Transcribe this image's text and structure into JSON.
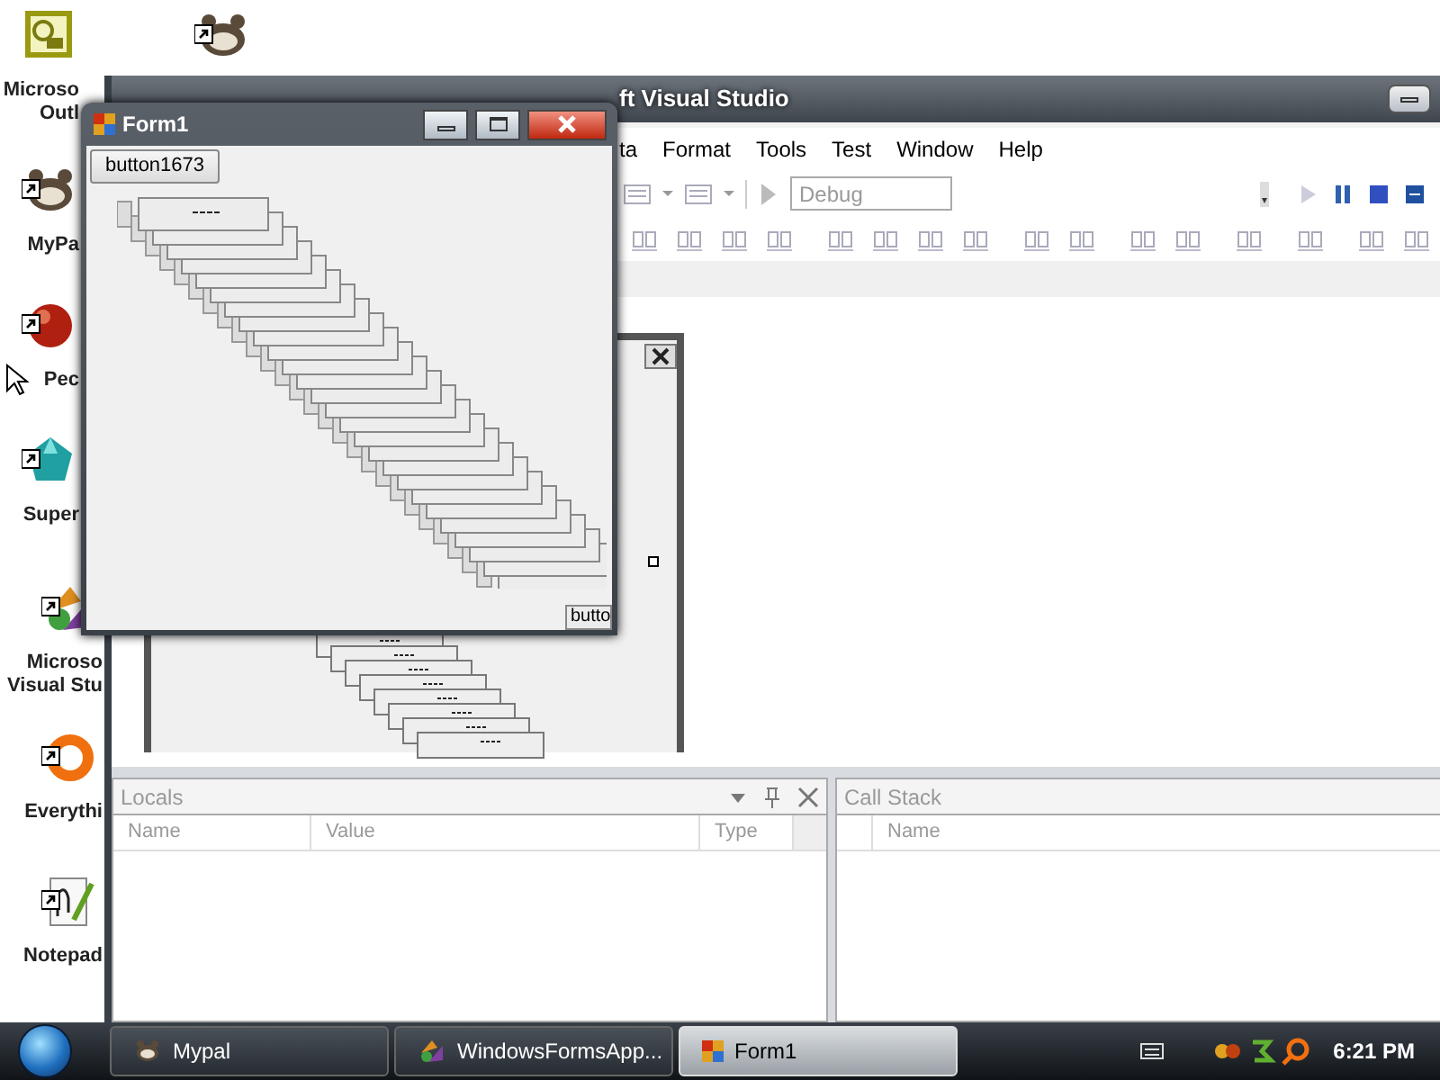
{
  "desktop": {
    "icons": [
      {
        "kind": "calendar",
        "lines": [
          "Microso",
          "Outl"
        ]
      },
      {
        "kind": "animal"
      },
      {
        "kind": "animal",
        "lines": [
          "MyPa"
        ]
      },
      {
        "kind": "ball",
        "lines": [
          "Pec"
        ]
      },
      {
        "kind": "gem",
        "lines": [
          "Super"
        ]
      },
      {
        "kind": "shapes",
        "lines": [
          "Microso",
          "Visual Stu"
        ]
      },
      {
        "kind": "ring",
        "lines": [
          "Everythi"
        ]
      },
      {
        "kind": "notepad",
        "lines": [
          "Notepad"
        ]
      }
    ]
  },
  "vs_window": {
    "title": "ft Visual Studio",
    "menu": [
      "ta",
      "Format",
      "Tools",
      "Test",
      "Window",
      "Help"
    ],
    "config_combo": "Debug",
    "locals": {
      "title": "Locals",
      "columns": [
        "Name",
        "Value",
        "Type"
      ]
    },
    "call_stack": {
      "title": "Call Stack",
      "columns": [
        "Name"
      ]
    }
  },
  "form1": {
    "title": "Form1",
    "first_button": "button1673",
    "last_button": "butto"
  },
  "taskbar": {
    "items": [
      {
        "kind": "animal",
        "label": "Mypal",
        "selected": false
      },
      {
        "kind": "shapes",
        "label": "WindowsFormsApp...",
        "selected": false
      },
      {
        "kind": "form",
        "label": "Form1",
        "selected": true
      }
    ],
    "clock": "6:21 PM"
  }
}
